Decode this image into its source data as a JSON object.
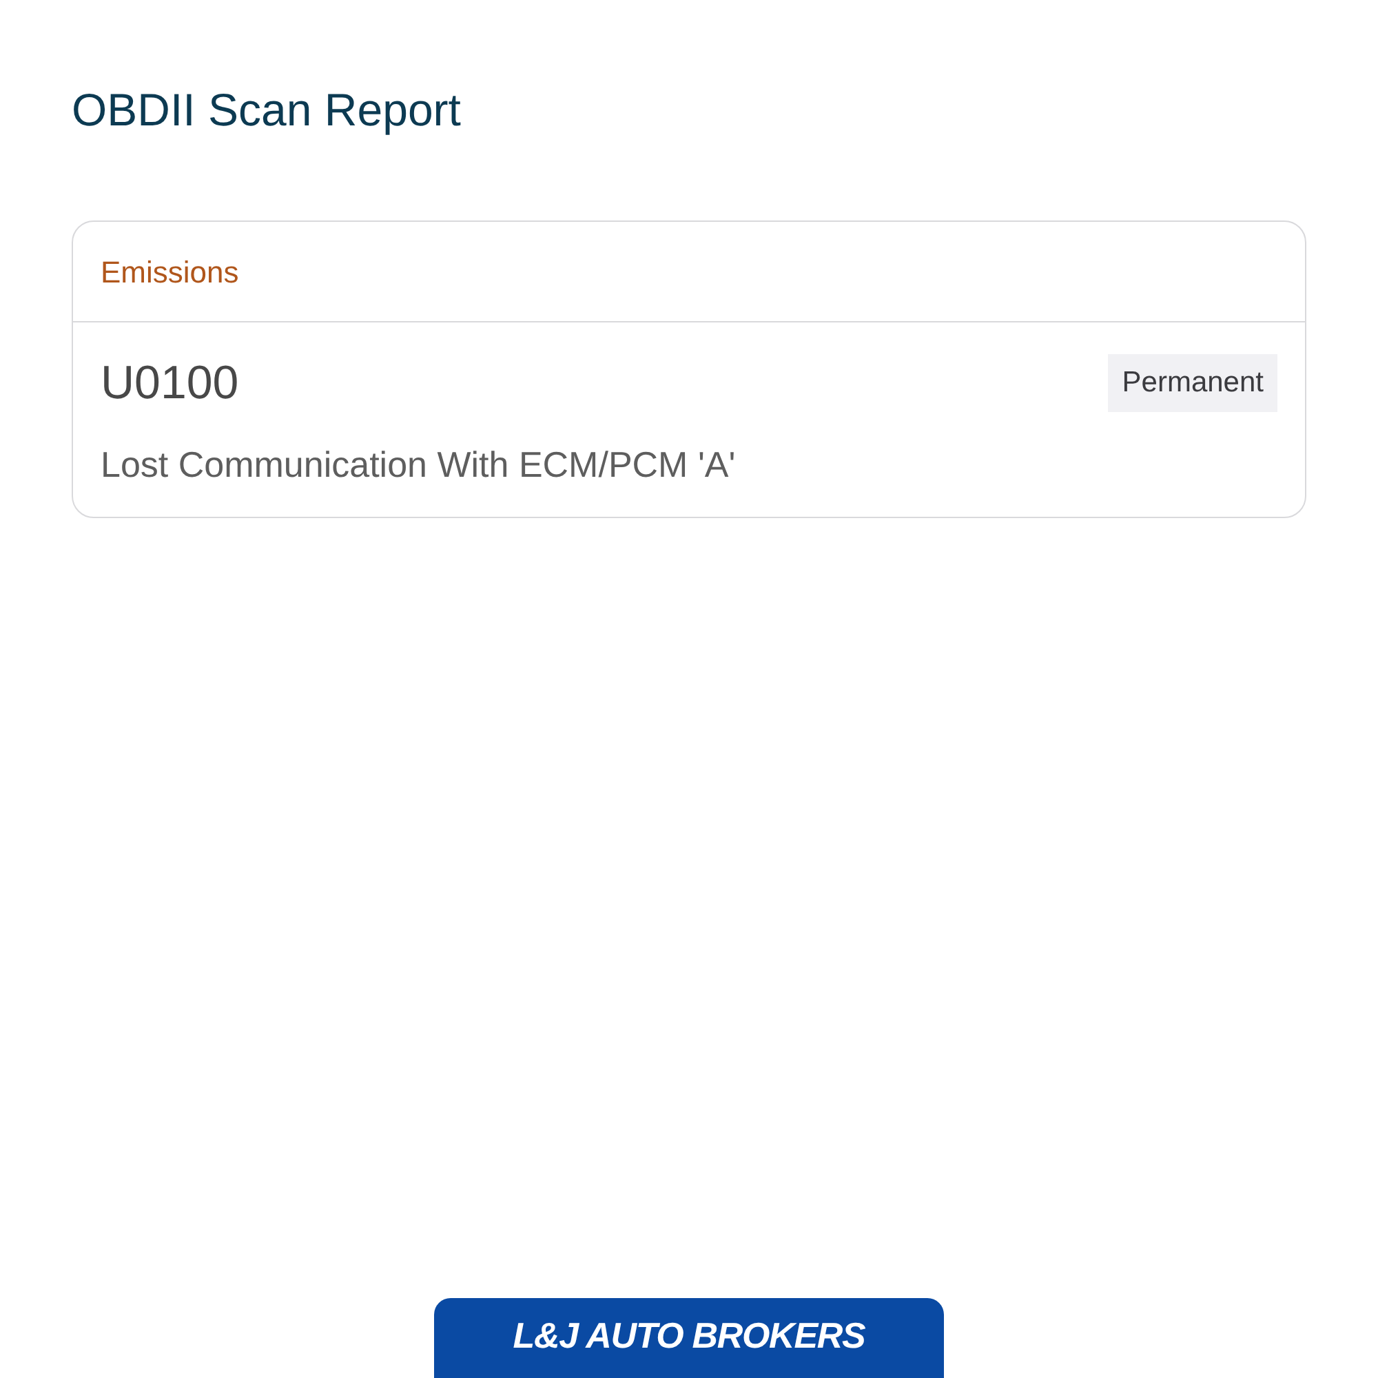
{
  "page": {
    "title": "OBDII Scan Report"
  },
  "sections": [
    {
      "title": "Emissions",
      "codes": [
        {
          "code": "U0100",
          "status": "Permanent",
          "description": "Lost Communication With ECM/PCM 'A'"
        }
      ]
    }
  ],
  "footer": {
    "logo_text": "L&J AUTO BROKERS"
  }
}
